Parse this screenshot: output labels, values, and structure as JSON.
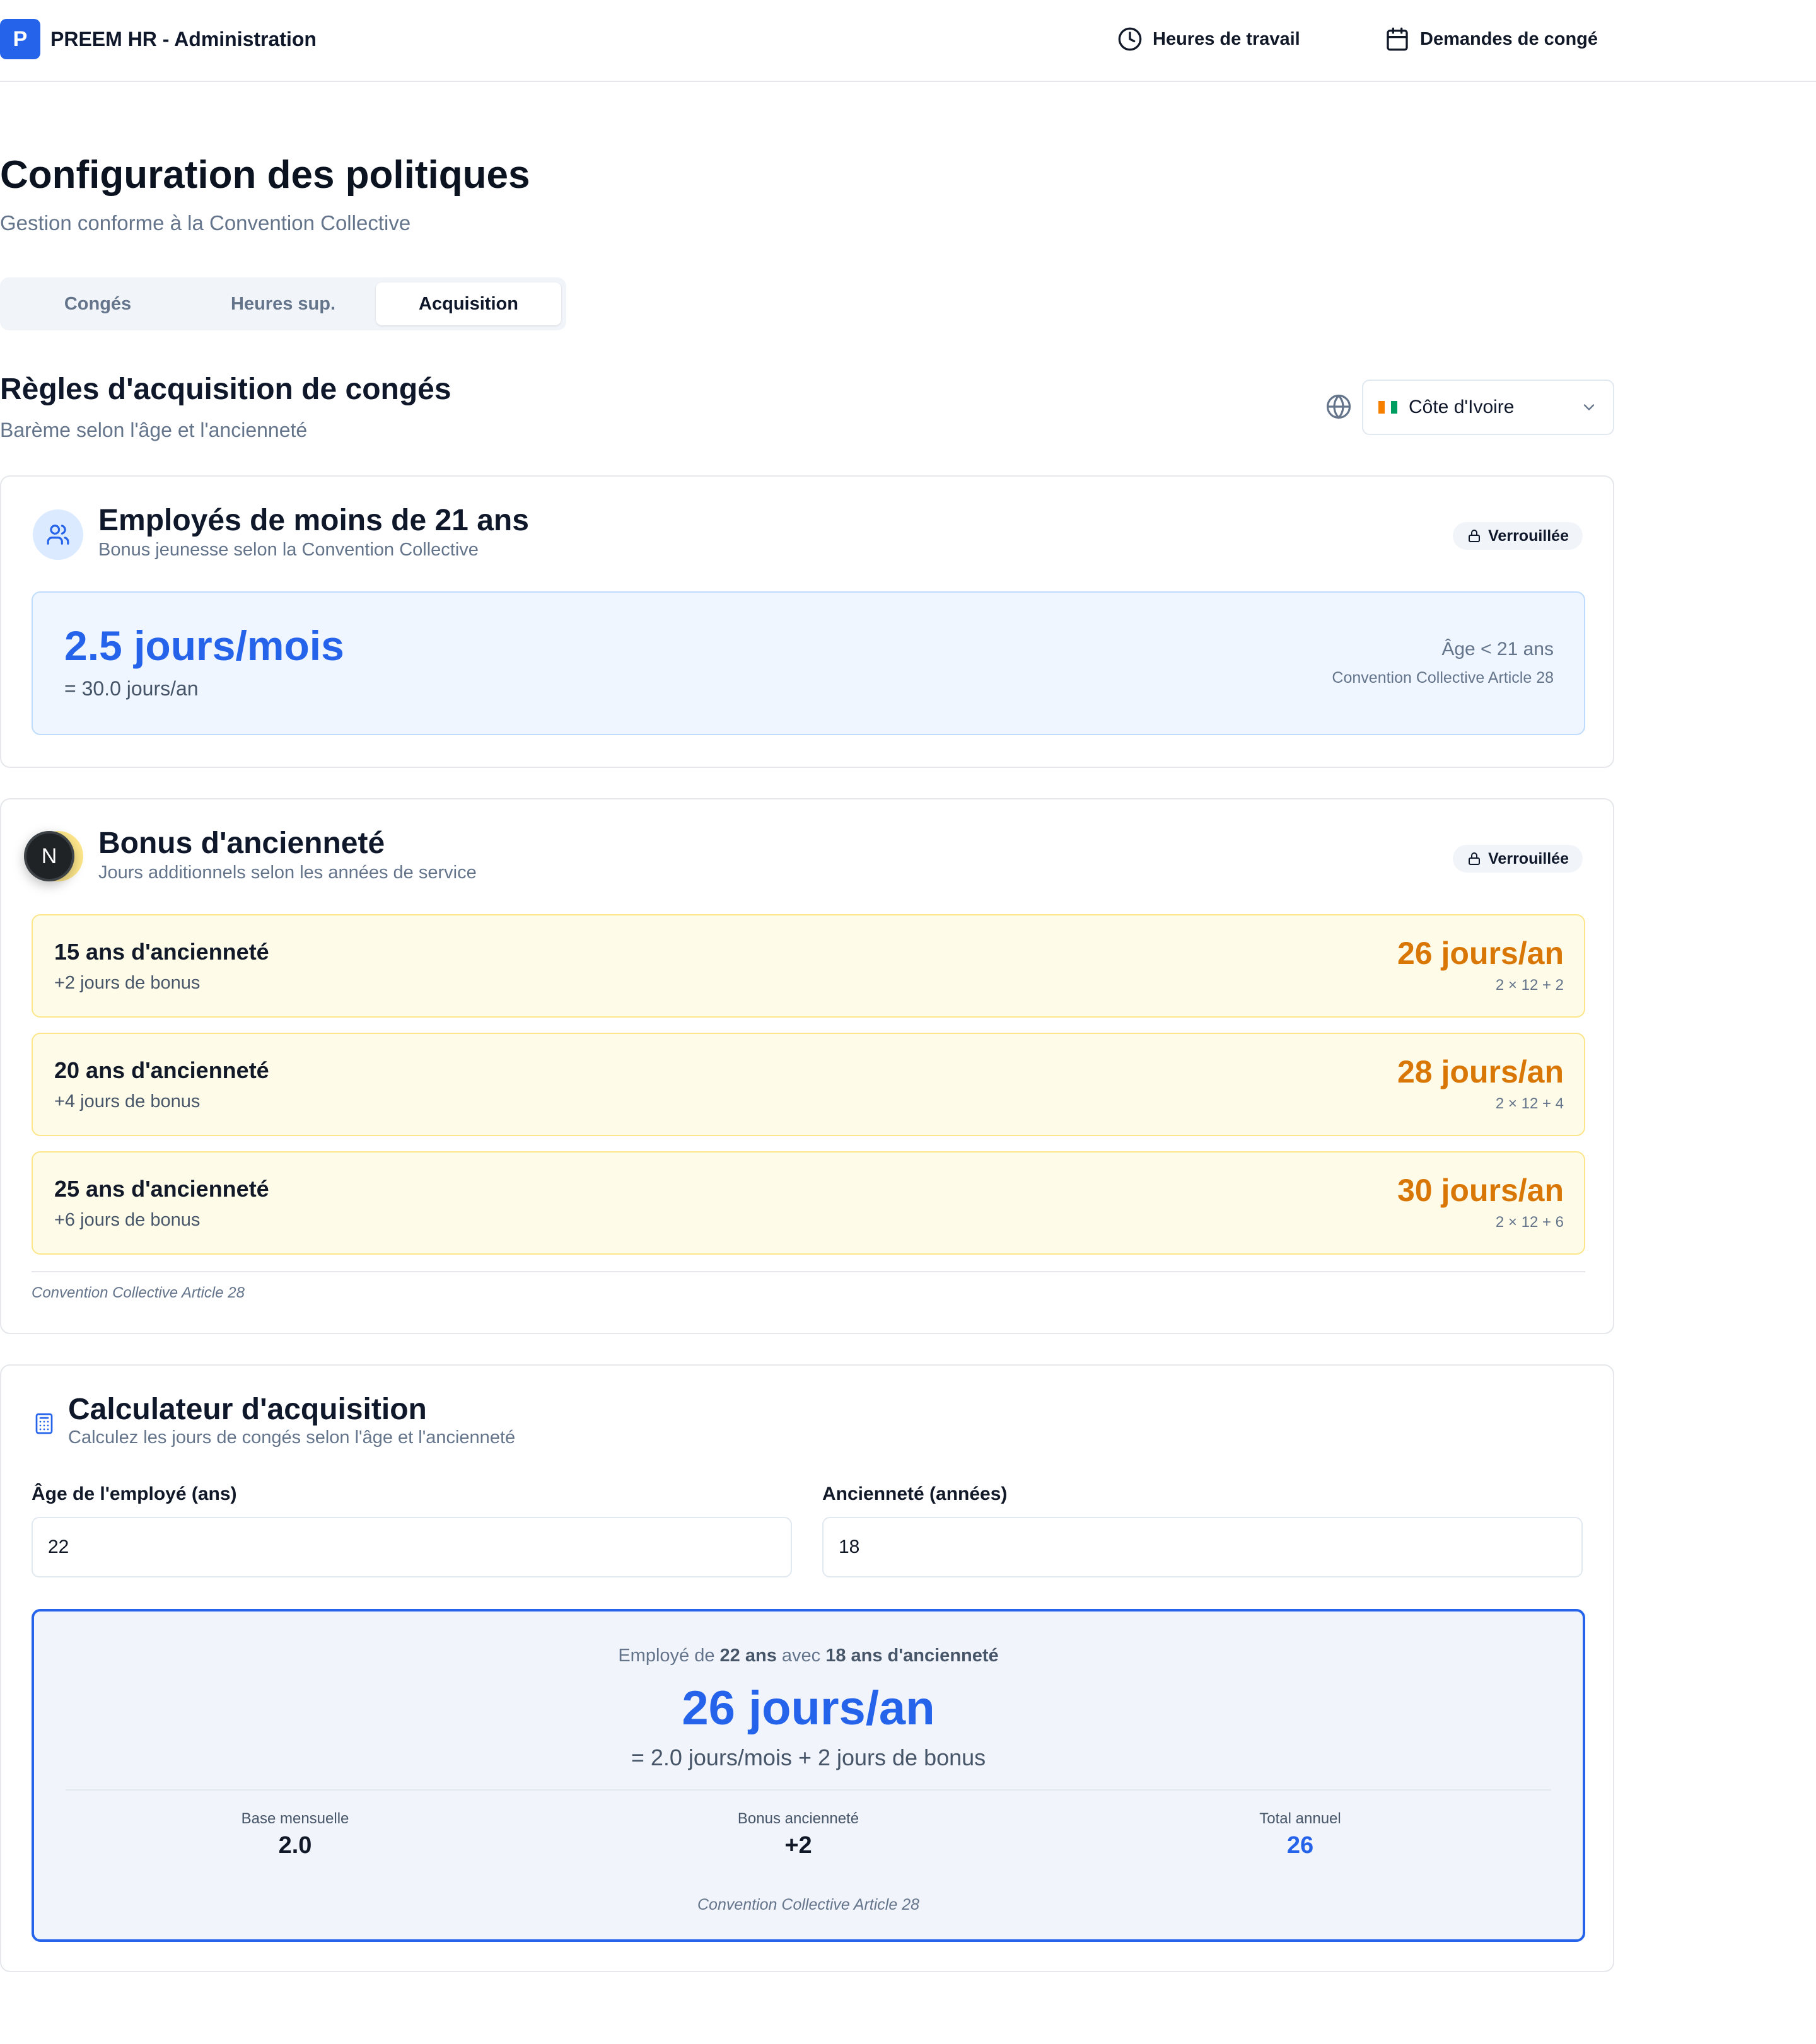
{
  "header": {
    "logo_letter": "P",
    "app_title": "PREEM HR - Administration",
    "nav": [
      {
        "label": "Heures de travail",
        "icon": "clock-icon"
      },
      {
        "label": "Demandes de congé",
        "icon": "calendar-icon"
      }
    ]
  },
  "page": {
    "title": "Configuration des politiques",
    "subtitle": "Gestion conforme à la Convention Collective"
  },
  "tabs": [
    {
      "label": "Congés",
      "active": false
    },
    {
      "label": "Heures sup.",
      "active": false
    },
    {
      "label": "Acquisition",
      "active": true
    }
  ],
  "section": {
    "title": "Règles d'acquisition de congés",
    "subtitle": "Barème selon l'âge et l'ancienneté",
    "country": "Côte d'Ivoire",
    "flag_colors": [
      "#f77f00",
      "#ffffff",
      "#009e60"
    ]
  },
  "youth": {
    "title": "Employés de moins de 21 ans",
    "subtitle": "Bonus jeunesse selon la Convention Collective",
    "badge": "Verrouillée",
    "rate": "2.5 jours/mois",
    "annual": "= 30.0 jours/an",
    "condition": "Âge < 21 ans",
    "reference": "Convention Collective Article 28"
  },
  "seniority": {
    "avatar_letter": "N",
    "title": "Bonus d'ancienneté",
    "subtitle": "Jours additionnels selon les années de service",
    "badge": "Verrouillée",
    "tiers": [
      {
        "title": "15 ans d'ancienneté",
        "bonus": "+2 jours de bonus",
        "value": "26 jours/an",
        "formula": "2 × 12 + 2"
      },
      {
        "title": "20 ans d'ancienneté",
        "bonus": "+4 jours de bonus",
        "value": "28 jours/an",
        "formula": "2 × 12 + 4"
      },
      {
        "title": "25 ans d'ancienneté",
        "bonus": "+6 jours de bonus",
        "value": "30 jours/an",
        "formula": "2 × 12 + 6"
      }
    ],
    "reference": "Convention Collective Article 28"
  },
  "calculator": {
    "title": "Calculateur d'acquisition",
    "subtitle": "Calculez les jours de congés selon l'âge et l'ancienneté",
    "age_label": "Âge de l'employé (ans)",
    "age_value": "22",
    "seniority_label": "Ancienneté (années)",
    "seniority_value": "18",
    "result": {
      "caption_prefix": "Employé de ",
      "caption_age": "22 ans",
      "caption_mid": " avec ",
      "caption_seniority": "18 ans d'ancienneté",
      "main": "26 jours/an",
      "formula": "= 2.0 jours/mois + 2 jours de bonus",
      "stats": [
        {
          "label": "Base mensuelle",
          "value": "2.0"
        },
        {
          "label": "Bonus ancienneté",
          "value": "+2"
        },
        {
          "label": "Total annuel",
          "value": "26"
        }
      ],
      "reference": "Convention Collective Article 28"
    }
  }
}
